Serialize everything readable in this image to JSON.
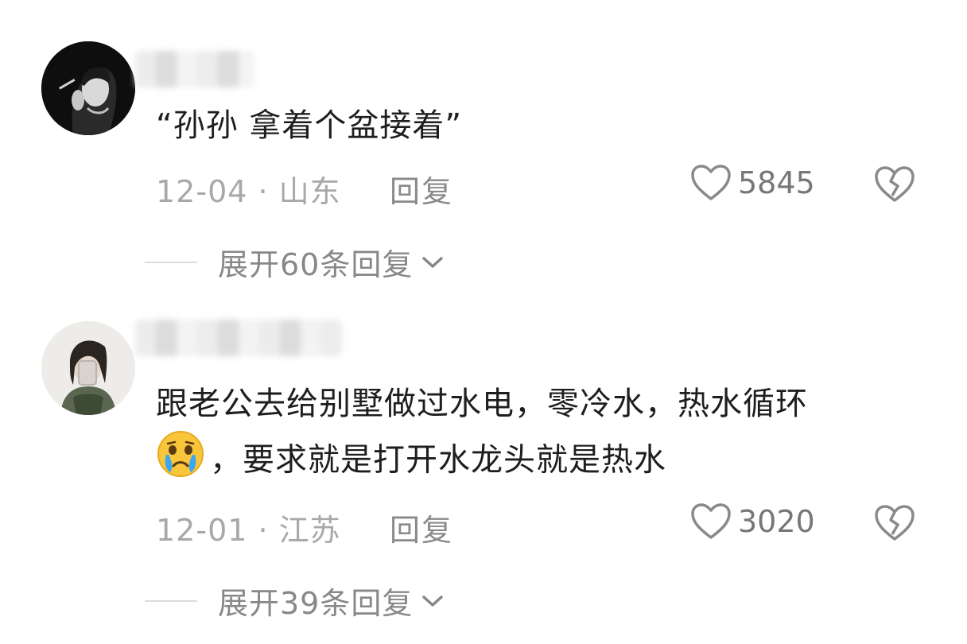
{
  "comments": [
    {
      "text": "“孙孙 拿着个盆接着”",
      "date_region": "12-04 · 山东",
      "reply_label": "回复",
      "like_count": "5845",
      "expand_label": "展开60条回复"
    },
    {
      "emoji": "crying-face",
      "text_line1": "跟老公去给别墅做过水电，零冷水，热水循环",
      "text_line2": "，要求就是打开水龙头就是热水",
      "date_region": "12-01 · 江苏",
      "reply_label": "回复",
      "like_count": "3020",
      "expand_label": "展开39条回复"
    }
  ],
  "icons": {
    "like": "heart-outline-icon",
    "dislike": "broken-heart-icon",
    "expand": "chevron-down-icon"
  },
  "colors": {
    "text": "#1e1e1e",
    "meta": "#a8a8a8",
    "icon": "#888888"
  }
}
